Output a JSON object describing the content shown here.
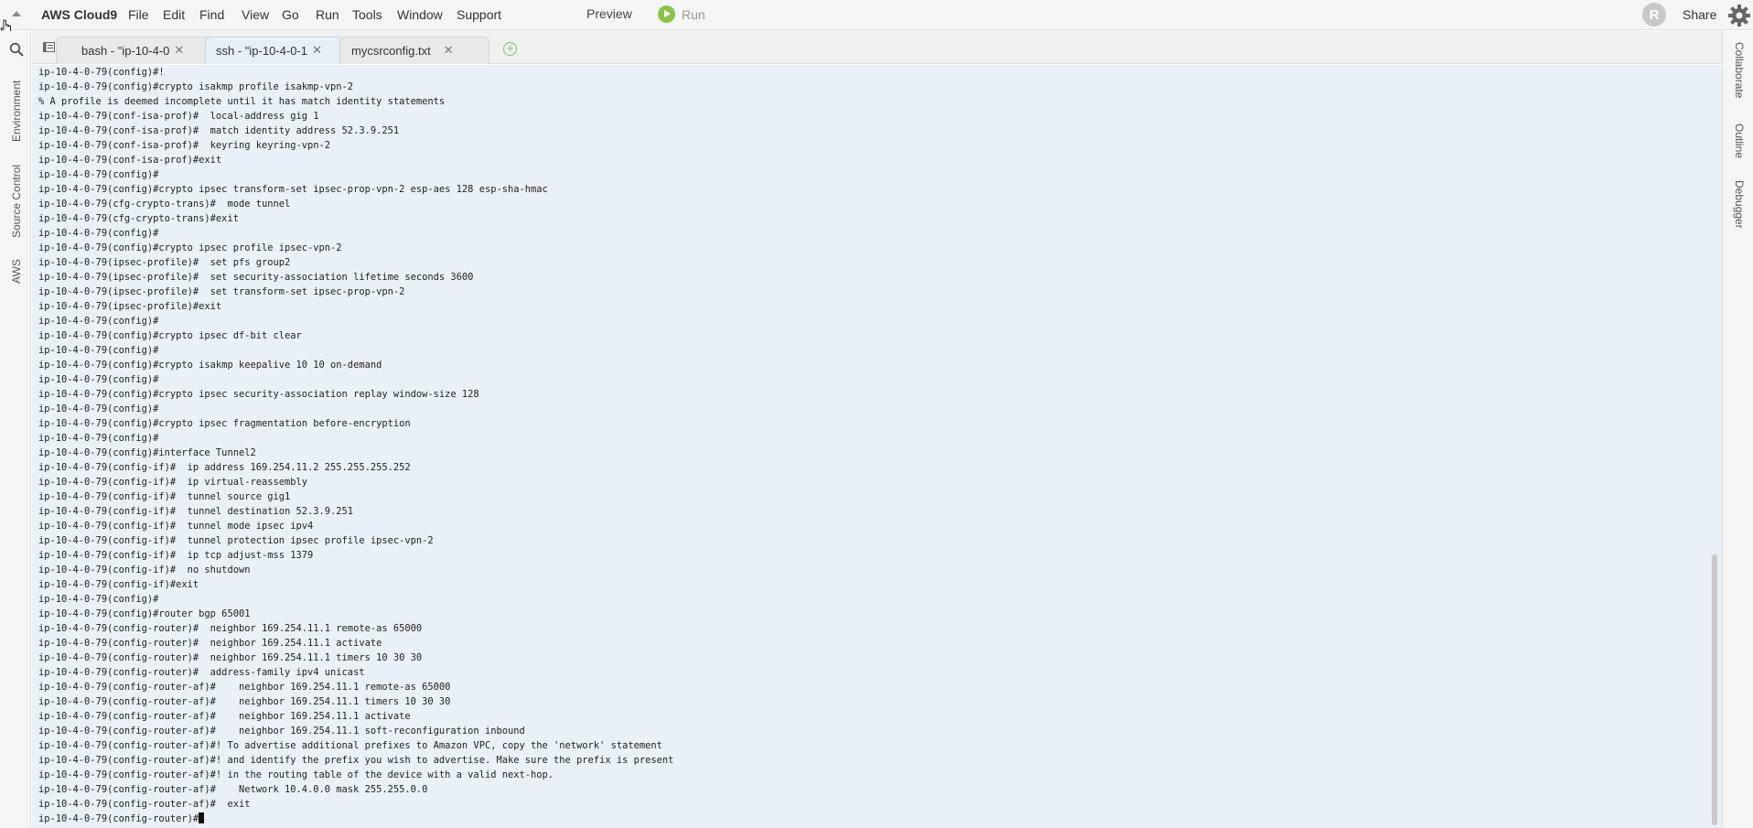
{
  "menubar": {
    "brand": "AWS Cloud9",
    "items": [
      "File",
      "Edit",
      "Find",
      "View",
      "Go",
      "Run",
      "Tools",
      "Window",
      "Support"
    ],
    "preview_label": "Preview",
    "run_label": "Run",
    "avatar_initial": "R",
    "share_label": "Share"
  },
  "left_sidebar": {
    "tabs": [
      "Environment",
      "Source Control",
      "AWS"
    ]
  },
  "right_sidebar": {
    "tabs": [
      "Collaborate",
      "Outline",
      "Debugger"
    ]
  },
  "tabs": [
    {
      "label": "bash - \"ip-10-4-0",
      "active": false
    },
    {
      "label": "ssh - \"ip-10-4-0-1",
      "active": true
    },
    {
      "label": "mycsrconfig.txt",
      "active": false
    }
  ],
  "terminal": {
    "lines": [
      "ip-10-4-0-79(config)#!",
      "ip-10-4-0-79(config)#crypto isakmp profile isakmp-vpn-2",
      "% A profile is deemed incomplete until it has match identity statements",
      "ip-10-4-0-79(conf-isa-prof)#  local-address gig 1",
      "ip-10-4-0-79(conf-isa-prof)#  match identity address 52.3.9.251",
      "ip-10-4-0-79(conf-isa-prof)#  keyring keyring-vpn-2",
      "ip-10-4-0-79(conf-isa-prof)#exit",
      "ip-10-4-0-79(config)#",
      "ip-10-4-0-79(config)#crypto ipsec transform-set ipsec-prop-vpn-2 esp-aes 128 esp-sha-hmac",
      "ip-10-4-0-79(cfg-crypto-trans)#  mode tunnel",
      "ip-10-4-0-79(cfg-crypto-trans)#exit",
      "ip-10-4-0-79(config)#",
      "ip-10-4-0-79(config)#crypto ipsec profile ipsec-vpn-2",
      "ip-10-4-0-79(ipsec-profile)#  set pfs group2",
      "ip-10-4-0-79(ipsec-profile)#  set security-association lifetime seconds 3600",
      "ip-10-4-0-79(ipsec-profile)#  set transform-set ipsec-prop-vpn-2",
      "ip-10-4-0-79(ipsec-profile)#exit",
      "ip-10-4-0-79(config)#",
      "ip-10-4-0-79(config)#crypto ipsec df-bit clear",
      "ip-10-4-0-79(config)#",
      "ip-10-4-0-79(config)#crypto isakmp keepalive 10 10 on-demand",
      "ip-10-4-0-79(config)#",
      "ip-10-4-0-79(config)#crypto ipsec security-association replay window-size 128",
      "ip-10-4-0-79(config)#",
      "ip-10-4-0-79(config)#crypto ipsec fragmentation before-encryption",
      "ip-10-4-0-79(config)#",
      "ip-10-4-0-79(config)#interface Tunnel2",
      "ip-10-4-0-79(config-if)#  ip address 169.254.11.2 255.255.255.252",
      "ip-10-4-0-79(config-if)#  ip virtual-reassembly",
      "ip-10-4-0-79(config-if)#  tunnel source gig1",
      "ip-10-4-0-79(config-if)#  tunnel destination 52.3.9.251",
      "ip-10-4-0-79(config-if)#  tunnel mode ipsec ipv4",
      "ip-10-4-0-79(config-if)#  tunnel protection ipsec profile ipsec-vpn-2",
      "ip-10-4-0-79(config-if)#  ip tcp adjust-mss 1379",
      "ip-10-4-0-79(config-if)#  no shutdown",
      "ip-10-4-0-79(config-if)#exit",
      "ip-10-4-0-79(config)#",
      "ip-10-4-0-79(config)#router bgp 65001",
      "ip-10-4-0-79(config-router)#  neighbor 169.254.11.1 remote-as 65000",
      "ip-10-4-0-79(config-router)#  neighbor 169.254.11.1 activate",
      "ip-10-4-0-79(config-router)#  neighbor 169.254.11.1 timers 10 30 30",
      "ip-10-4-0-79(config-router)#  address-family ipv4 unicast",
      "ip-10-4-0-79(config-router-af)#    neighbor 169.254.11.1 remote-as 65000",
      "ip-10-4-0-79(config-router-af)#    neighbor 169.254.11.1 timers 10 30 30",
      "ip-10-4-0-79(config-router-af)#    neighbor 169.254.11.1 activate",
      "ip-10-4-0-79(config-router-af)#    neighbor 169.254.11.1 soft-reconfiguration inbound",
      "ip-10-4-0-79(config-router-af)#! To advertise additional prefixes to Amazon VPC, copy the 'network' statement",
      "ip-10-4-0-79(config-router-af)#! and identify the prefix you wish to advertise. Make sure the prefix is present",
      "ip-10-4-0-79(config-router-af)#! in the routing table of the device with a valid next-hop.",
      "ip-10-4-0-79(config-router-af)#    Network 10.4.0.0 mask 255.255.0.0",
      "ip-10-4-0-79(config-router-af)#  exit"
    ],
    "prompt": "ip-10-4-0-79(config-router)#"
  },
  "colors": {
    "terminal_bg": "#e9f0f7",
    "run_green": "#8bc34a",
    "add_tab_green": "#7cc36c"
  },
  "icons": [
    "collapse-arrow-icon",
    "search-icon",
    "run-icon",
    "gear-icon",
    "tab-list-icon",
    "add-tab-icon",
    "close-icon"
  ]
}
